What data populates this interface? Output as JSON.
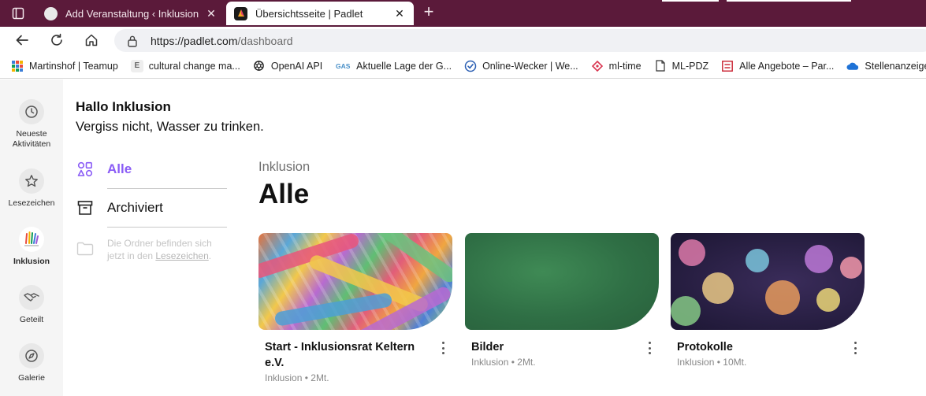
{
  "browser": {
    "tabs": [
      {
        "title": "Add Veranstaltung ‹ Inklusionsrat",
        "close": "✕",
        "active": false
      },
      {
        "title": "Übersichtsseite | Padlet",
        "close": "✕",
        "active": true
      }
    ],
    "new_tab": "+",
    "url_host": "https://padlet.com",
    "url_path": "/dashboard",
    "bookmarks": [
      {
        "label": "Martinshof | Teamup",
        "icon": "grid-icon"
      },
      {
        "label": "cultural change ma...",
        "icon": "letter-e-icon",
        "icon_text": "E"
      },
      {
        "label": "OpenAI API",
        "icon": "openai-icon"
      },
      {
        "label": "Aktuelle Lage der G...",
        "icon": "gas-icon",
        "icon_text": "GAS"
      },
      {
        "label": "Online-Wecker | We...",
        "icon": "clock-check-icon"
      },
      {
        "label": "ml-time",
        "icon": "target-icon"
      },
      {
        "label": "ML-PDZ",
        "icon": "page-icon"
      },
      {
        "label": "Alle Angebote – Par...",
        "icon": "form-icon"
      },
      {
        "label": "Stellenanzeigen gG...",
        "icon": "cloud-icon"
      }
    ]
  },
  "rail": {
    "items": [
      {
        "label": "Neueste Aktivitäten",
        "icon": "clock-icon"
      },
      {
        "label": "Lesezeichen",
        "icon": "star-icon"
      },
      {
        "label": "Inklusion",
        "icon": "inklusion-logo-icon"
      },
      {
        "label": "Geteilt",
        "icon": "handshake-icon"
      },
      {
        "label": "Galerie",
        "icon": "compass-icon"
      }
    ]
  },
  "greeting": {
    "title": "Hallo Inklusion",
    "subtitle": "Vergiss nicht, Wasser zu trinken."
  },
  "folders": {
    "all": "Alle",
    "archived": "Archiviert",
    "hint_text": "Die Ordner befinden sich jetzt in den ",
    "hint_link": "Lesezeichen",
    "hint_end": "."
  },
  "main": {
    "breadcrumb": "Inklusion",
    "title": "Alle",
    "cards": [
      {
        "title": "Start - Inklusionsrat Keltern e.V.",
        "owner": "Inklusion",
        "sep": "•",
        "age": "2Mt."
      },
      {
        "title": "Bilder",
        "owner": "Inklusion",
        "sep": "•",
        "age": "2Mt."
      },
      {
        "title": "Protokolle",
        "owner": "Inklusion",
        "sep": "•",
        "age": "10Mt."
      }
    ]
  },
  "colors": {
    "tabbar": "#5b1a3a",
    "accent": "#8a5cf6",
    "rail_bg": "#f5f5f5"
  }
}
